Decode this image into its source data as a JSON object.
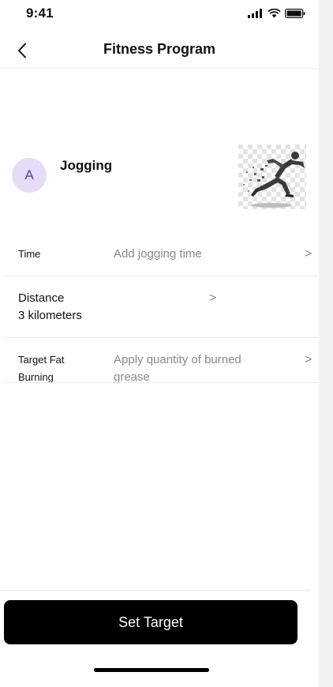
{
  "status_bar": {
    "time": "9:41",
    "icons": [
      "signal-icon",
      "wifi-icon",
      "battery-icon"
    ]
  },
  "nav": {
    "title": "Fitness Program",
    "back_icon": "chevron-left-icon"
  },
  "activity": {
    "avatar_letter": "A",
    "title": "Jogging",
    "image": "running-figure-image",
    "avatar_color": "#e6dcfa"
  },
  "rows": {
    "time": {
      "label": "Time",
      "placeholder": "Add jogging time",
      "chevron": ">"
    },
    "distance": {
      "label": "Distance",
      "value": "3 kilometers",
      "chevron": ">"
    },
    "fat": {
      "label_line1": "Target Fat",
      "label_line2": "Burning",
      "placeholder_line1": "Apply quantity of burned",
      "placeholder_line2": "grease",
      "chevron": ">"
    }
  },
  "cta": {
    "label": "Set Target",
    "color": "#000000"
  }
}
